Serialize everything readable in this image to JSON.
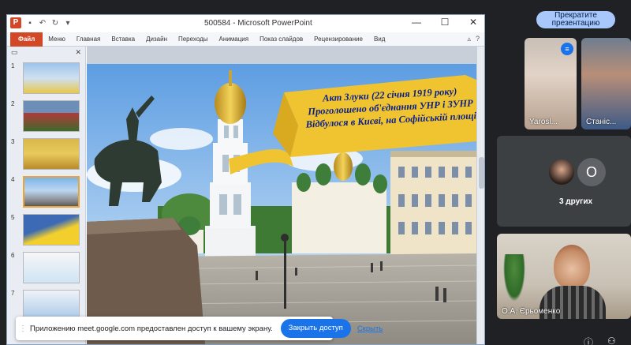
{
  "powerpoint": {
    "window_title": "500584 - Microsoft PowerPoint",
    "logo_letter": "P",
    "ribbon": {
      "file_tab": "Файл",
      "tabs": [
        "Меню",
        "Главная",
        "Вставка",
        "Дизайн",
        "Переходы",
        "Анимация",
        "Показ слайдов",
        "Рецензирование",
        "Вид"
      ]
    },
    "thumbnails": {
      "numbers": [
        "1",
        "2",
        "3",
        "4",
        "5",
        "6",
        "7"
      ],
      "active_index": 4
    },
    "slide": {
      "banner_lines": [
        "Акт Злуки (22 січня 1919 року)",
        "Проголошено об'єднання УНР і ЗУНР",
        "Відбулося в Києві, на Софійській площі"
      ]
    }
  },
  "meet": {
    "stop_presenting_label": "Прекратите презентацию",
    "participants": [
      {
        "name": "Yarosl..."
      },
      {
        "name": "Станіс..."
      }
    ],
    "others_avatar_letter": "O",
    "others_label": "3 других",
    "presenter_name": "О.А. Єрьоменко"
  },
  "notification": {
    "message": "Приложению meet.google.com предоставлен доступ к вашему экрану.",
    "stop_button": "Закрыть доступ",
    "hide_link": "Скрыть"
  },
  "colors": {
    "ppt_accent": "#d24726",
    "meet_button": "#a8c7fa",
    "primary_blue": "#1a73e8",
    "banner_yellow": "#f0c431",
    "banner_text": "#0a1f8a"
  }
}
